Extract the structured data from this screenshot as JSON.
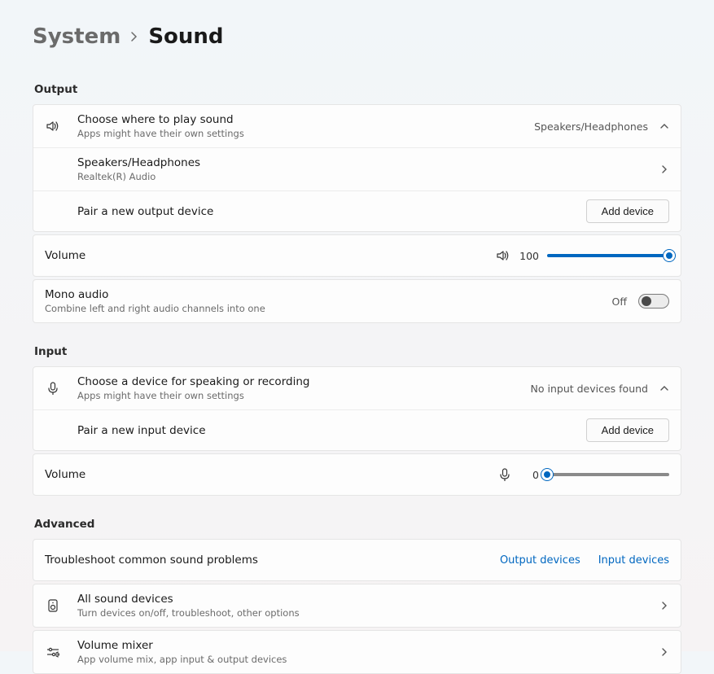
{
  "breadcrumb": {
    "parent": "System",
    "current": "Sound"
  },
  "output": {
    "section_label": "Output",
    "choose": {
      "title": "Choose where to play sound",
      "subtitle": "Apps might have their own settings",
      "value": "Speakers/Headphones"
    },
    "device": {
      "title": "Speakers/Headphones",
      "subtitle": "Realtek(R) Audio"
    },
    "pair": {
      "title": "Pair a new output device",
      "button": "Add device"
    },
    "volume": {
      "label": "Volume",
      "value": "100",
      "percent": 100
    },
    "mono": {
      "title": "Mono audio",
      "subtitle": "Combine left and right audio channels into one",
      "state": "Off"
    }
  },
  "input": {
    "section_label": "Input",
    "choose": {
      "title": "Choose a device for speaking or recording",
      "subtitle": "Apps might have their own settings",
      "value": "No input devices found"
    },
    "pair": {
      "title": "Pair a new input device",
      "button": "Add device"
    },
    "volume": {
      "label": "Volume",
      "value": "0",
      "percent": 0
    }
  },
  "advanced": {
    "section_label": "Advanced",
    "troubleshoot": {
      "title": "Troubleshoot common sound problems",
      "output_link": "Output devices",
      "input_link": "Input devices"
    },
    "all_devices": {
      "title": "All sound devices",
      "subtitle": "Turn devices on/off, troubleshoot, other options"
    },
    "mixer": {
      "title": "Volume mixer",
      "subtitle": "App volume mix, app input & output devices"
    }
  }
}
